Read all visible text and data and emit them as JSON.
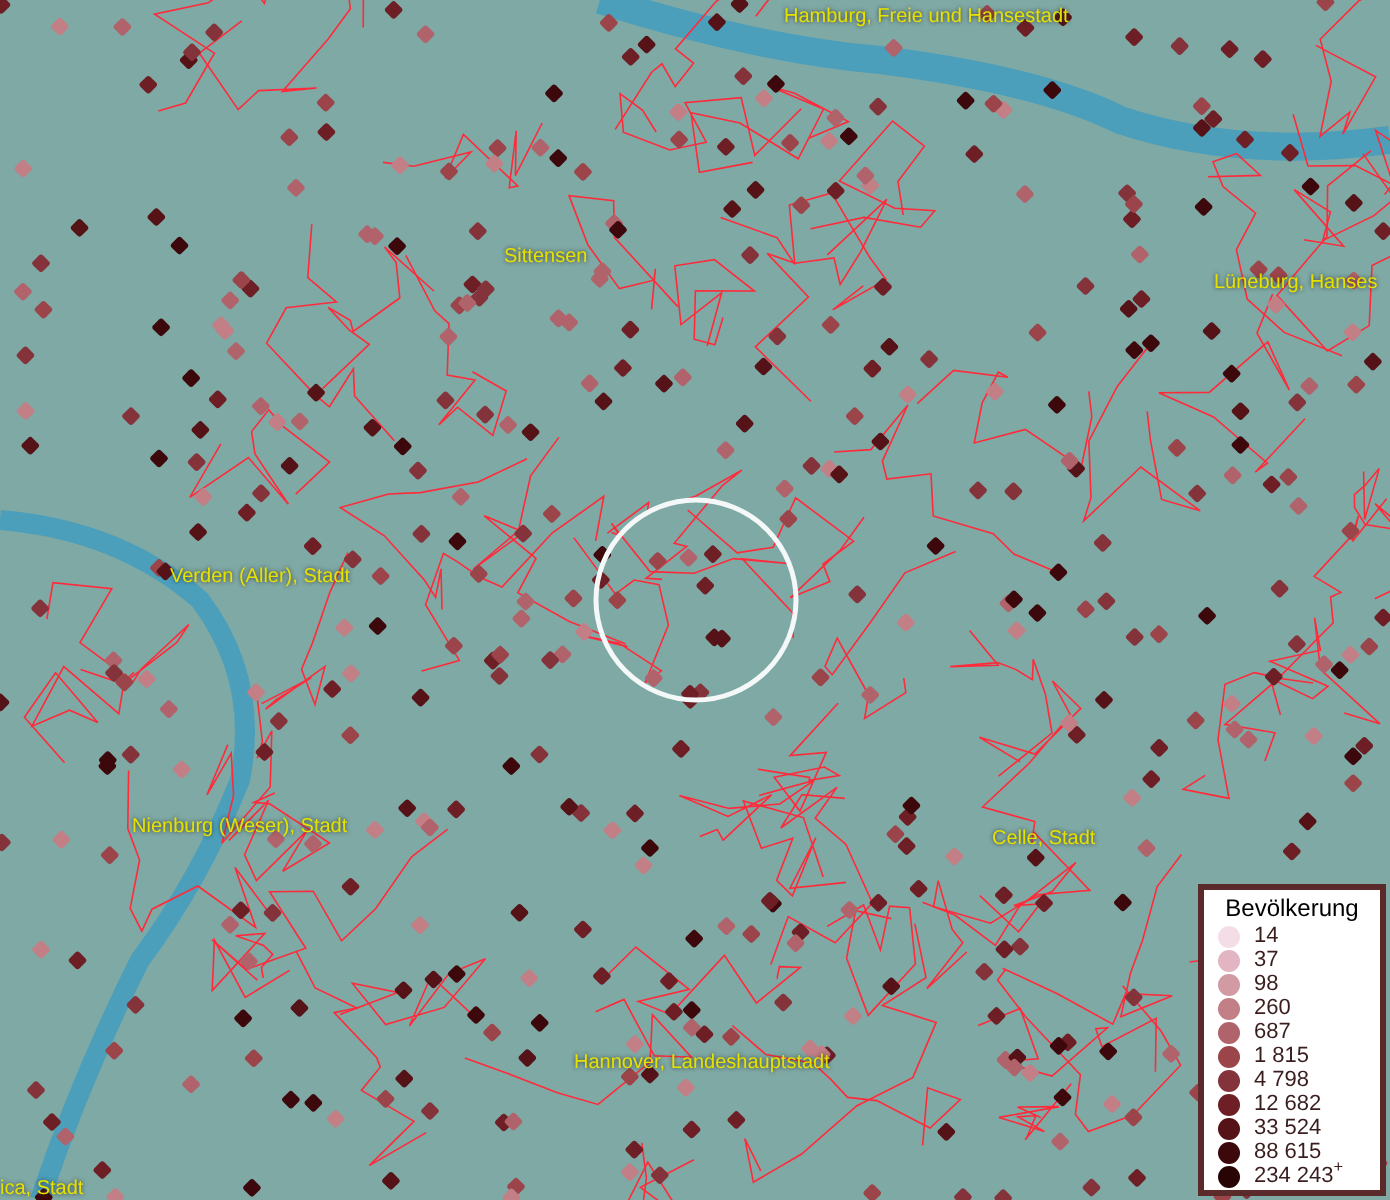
{
  "map": {
    "place_labels": [
      {
        "text": "Hamburg, Freie und Hansestadt"
      },
      {
        "text": "Sittensen"
      },
      {
        "text": "Lüneburg, Hanses"
      },
      {
        "text": "Verden (Aller), Stadt"
      },
      {
        "text": "Nienburg (Weser), Stadt"
      },
      {
        "text": "Celle, Stadt"
      },
      {
        "text": "Hannover, Landeshauptstadt"
      },
      {
        "text": "ica, Stadt"
      }
    ]
  },
  "legend": {
    "title": "Bevölkerung",
    "items": [
      {
        "label": "14",
        "color": "#f5dde8"
      },
      {
        "label": "37",
        "color": "#e3b5c2"
      },
      {
        "label": "98",
        "color": "#d29aa2"
      },
      {
        "label": "260",
        "color": "#c27f86"
      },
      {
        "label": "687",
        "color": "#b1636b"
      },
      {
        "label": "1 815",
        "color": "#9b454b"
      },
      {
        "label": "4 798",
        "color": "#85333b"
      },
      {
        "label": "12 682",
        "color": "#6e1f26"
      },
      {
        "label": "33 524",
        "color": "#551217"
      },
      {
        "label": "88 615",
        "color": "#3d080c"
      },
      {
        "label": "234 243$^{+}$",
        "color": "#280405"
      }
    ]
  }
}
